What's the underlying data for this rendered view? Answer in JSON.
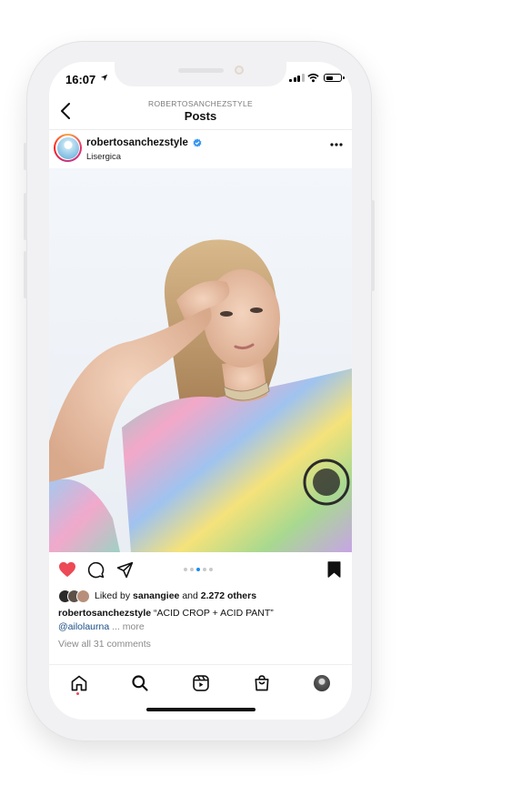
{
  "status_bar": {
    "time": "16:07"
  },
  "header": {
    "account": "ROBERTOSANCHEZSTYLE",
    "title": "Posts"
  },
  "post": {
    "username": "robertosanchezstyle",
    "location": "Lisergica",
    "carousel": {
      "count": 5,
      "active_index": 2
    },
    "likes": {
      "prefix": "Liked by",
      "first_user": "sanangiee",
      "and": "and",
      "others": "2.272 others"
    },
    "caption": {
      "username": "robertosanchezstyle",
      "text": " “ACID CROP + ACID PANT”"
    },
    "mention": "@ailolaurna",
    "more_label": "... more",
    "view_comments": "View all 31 comments"
  },
  "icons": {
    "back": "chevron-left-icon",
    "verified": "verified-badge-icon",
    "options": "more-horizontal-icon",
    "like": "heart-filled-icon",
    "comment": "comment-icon",
    "share": "send-icon",
    "save": "bookmark-filled-icon",
    "nav": [
      "home-icon",
      "search-icon",
      "reels-icon",
      "shop-icon",
      "profile-avatar"
    ]
  },
  "colors": {
    "like": "#ed4956",
    "verified": "#3897f0",
    "active_dot": "#1a8cf0",
    "link": "#1a4f86",
    "muted": "#8a8a8a"
  }
}
